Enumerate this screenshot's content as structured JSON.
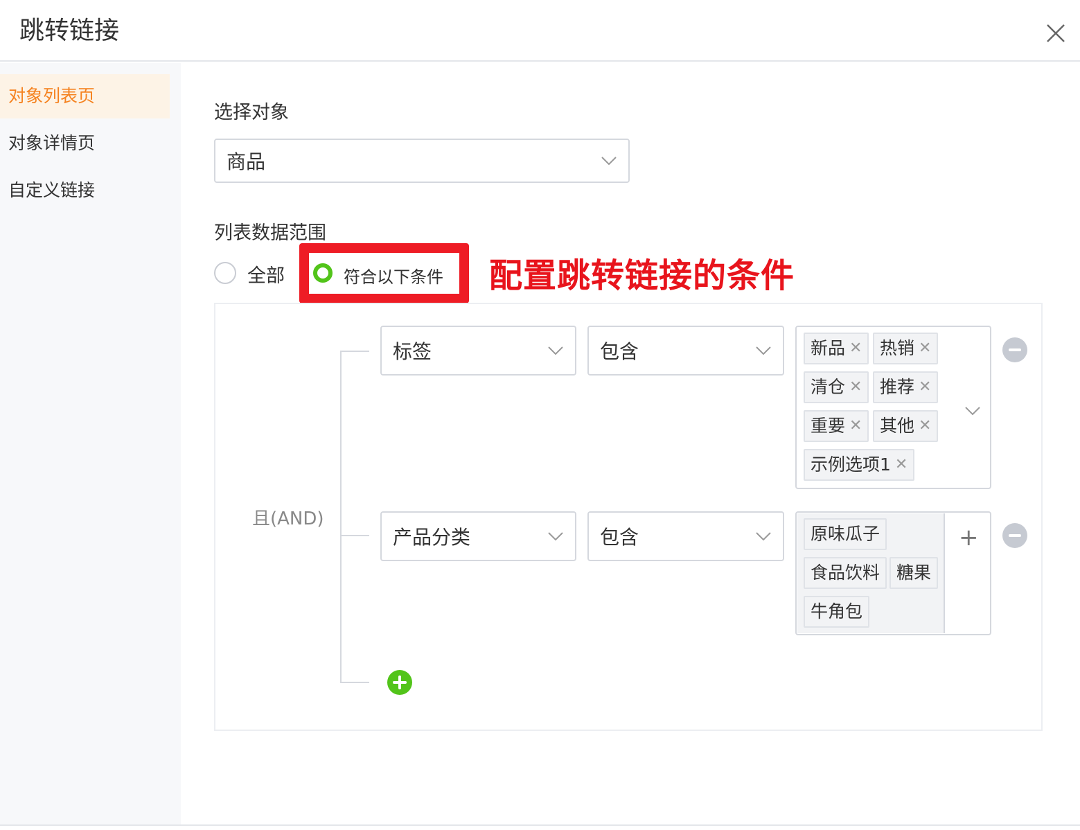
{
  "dialog": {
    "title": "跳转链接"
  },
  "sidebar": {
    "items": [
      {
        "label": "对象列表页",
        "active": true
      },
      {
        "label": "对象详情页",
        "active": false
      },
      {
        "label": "自定义链接",
        "active": false
      }
    ]
  },
  "form": {
    "object_label": "选择对象",
    "object_value": "商品",
    "range_label": "列表数据范围",
    "range_options": [
      {
        "label": "全部",
        "checked": false
      },
      {
        "label": "符合以下条件",
        "checked": true
      }
    ]
  },
  "annotation": {
    "text": "配置跳转链接的条件",
    "color": "#e8141c"
  },
  "conditions": {
    "logic_label": "且(AND)",
    "rows": [
      {
        "field": "标签",
        "operator": "包含",
        "values": [
          "新品",
          "热销",
          "清仓",
          "推荐",
          "重要",
          "其他",
          "示例选项1"
        ],
        "removable_tags": true
      },
      {
        "field": "产品分类",
        "operator": "包含",
        "values": [
          "原味瓜子",
          "食品饮料",
          "糖果",
          "牛角包"
        ],
        "removable_tags": false,
        "add_symbol": "+"
      }
    ]
  },
  "colors": {
    "accent_orange": "#f5821f",
    "success_green": "#52c41a",
    "highlight_red": "#ee1c25"
  }
}
